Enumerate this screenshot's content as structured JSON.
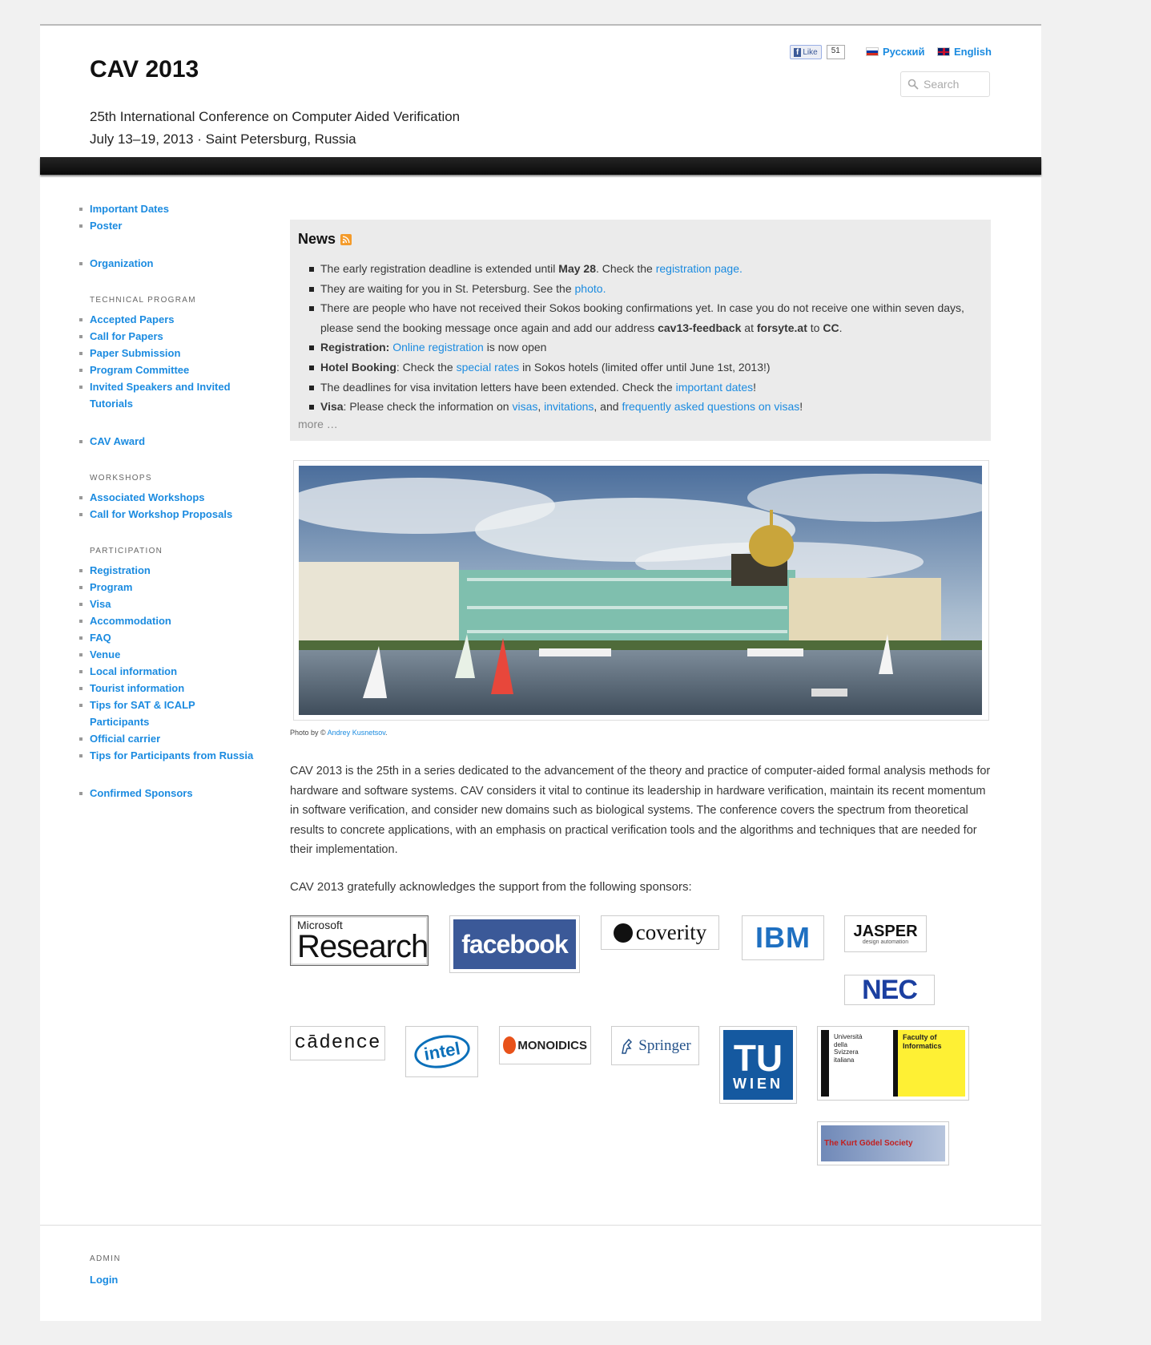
{
  "header": {
    "title": "CAV 2013",
    "subtitle": "25th International Conference on Computer Aided Verification",
    "dates": "July 13–19, 2013 · Saint Petersburg, Russia",
    "fb_like": "Like",
    "fb_count": "51",
    "lang_ru": "Русский",
    "lang_en": "English",
    "search_placeholder": "Search"
  },
  "sidebar": {
    "group1": [
      "Important Dates",
      "Poster"
    ],
    "group2": [
      "Organization"
    ],
    "technical_heading": "TECHNICAL PROGRAM",
    "technical": [
      "Accepted Papers",
      "Call for Papers",
      "Paper Submission",
      "Program Committee",
      "Invited Speakers and Invited Tutorials"
    ],
    "award": [
      "CAV Award"
    ],
    "workshops_heading": "WORKSHOPS",
    "workshops": [
      "Associated Workshops",
      "Call for Workshop Proposals"
    ],
    "participation_heading": "PARTICIPATION",
    "participation": [
      "Registration",
      "Program",
      "Visa",
      "Accommodation",
      "FAQ",
      "Venue",
      "Local information",
      "Tourist information",
      "Tips for SAT & ICALP Participants",
      "Official carrier",
      "Tips for Participants from Russia"
    ],
    "sponsors": [
      "Confirmed Sponsors"
    ]
  },
  "news": {
    "title": "News",
    "items": {
      "i1": {
        "t1": "The early registration deadline is extended until ",
        "b1": "May 28",
        "t2": ". Check the ",
        "l1": "registration page",
        "t3": "."
      },
      "i2": {
        "t1": "They are waiting for you in St. Petersburg. See the ",
        "l1": "photo",
        "t2": "."
      },
      "i3": {
        "t1": "There are people who have not received their Sokos booking confirmations yet. In case you do not receive one within seven days, please send the booking message once again and add our address ",
        "b1": "cav13-feedback",
        "t2": " at ",
        "b2": "forsyte.at",
        "t3": " to ",
        "b3": "CC",
        "t4": "."
      },
      "i4": {
        "b1": "Registration:",
        "t1": " ",
        "l1": "Online registration",
        "t2": " is now open"
      },
      "i5": {
        "b1": "Hotel Booking",
        "t1": ": Check the ",
        "l1": "special rates",
        "t2": " in Sokos hotels (limited offer until June 1st, 2013!)"
      },
      "i6": {
        "t1": "The deadlines for visa invitation letters have been extended. Check the ",
        "l1": "important dates",
        "t2": "!"
      },
      "i7": {
        "b1": "Visa",
        "t1": ": Please check the information on ",
        "l1": "visas",
        "t2": ", ",
        "l2": "invitations",
        "t3": ", and ",
        "l3": "frequently asked questions on visas",
        "t4": "!"
      }
    },
    "more": "more …"
  },
  "photo": {
    "caption_prefix": "Photo by © ",
    "caption_author": "Andrey Kusnetsov",
    "caption_suffix": "."
  },
  "about": "CAV 2013 is the 25th in a series dedicated to the advancement of the theory and practice of computer-aided formal analysis methods for hardware and software systems. CAV considers it vital to continue its leadership in hardware verification, maintain its recent momentum in software verification, and consider new domains such as biological systems. The conference covers the spectrum from theoretical results to concrete applications, with an emphasis on practical verification tools and the algorithms and techniques that are needed for their implementation.",
  "acknowledgement": "CAV 2013 gratefully acknowledges the support from the following sponsors:",
  "sponsor_logos": {
    "microsoft_top": "Microsoft",
    "microsoft_bottom": "Research",
    "facebook": "facebook",
    "coverity": "coverity",
    "ibm": "IBM",
    "jasper": "JASPER",
    "jasper_sub": "design automation",
    "nec": "NEC",
    "cadence": "cādence",
    "intel": "intel",
    "monoidics": "MONOIDICS",
    "springer": "Springer",
    "tu_top": "TU",
    "tu_bottom": "WIEN",
    "usi_left": "Università della Svizzera italiana",
    "usi_right": "Faculty of Informatics",
    "goedel": "The Kurt Gödel Society"
  },
  "footer": {
    "admin_heading": "ADMIN",
    "login": "Login"
  },
  "colors": {
    "link": "#1b8be0",
    "navbar": "#111111",
    "news_bg": "#ebebeb",
    "facebook": "#3b5998",
    "ibm": "#1f70c1",
    "nec": "#1b3fa0"
  }
}
